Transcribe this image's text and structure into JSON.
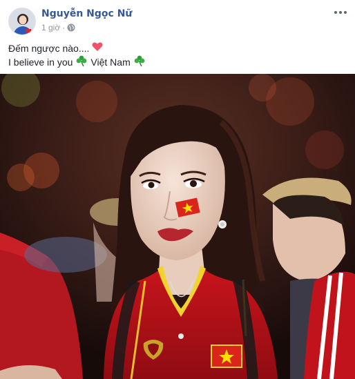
{
  "post": {
    "author_name": "Nguyễn Ngọc Nữ",
    "timestamp": "1 giờ",
    "separator": "·",
    "privacy_icon": "globe-icon",
    "more_icon": "more-options-icon",
    "text_lines": [
      {
        "text": "Đếm ngược nào....",
        "emoji": "heart-emoji"
      },
      {
        "text": "I believe in you",
        "emoji": "shamrock-emoji",
        "text_after": "Việt Nam",
        "emoji_after": "shamrock-emoji"
      }
    ],
    "colors": {
      "author_link": "#365899",
      "meta_grey": "#90949c",
      "heart": "#f25268",
      "shamrock": "#2e9e3a"
    }
  },
  "photo": {
    "description_icon": "photo-fan-with-vietnam-flag"
  }
}
